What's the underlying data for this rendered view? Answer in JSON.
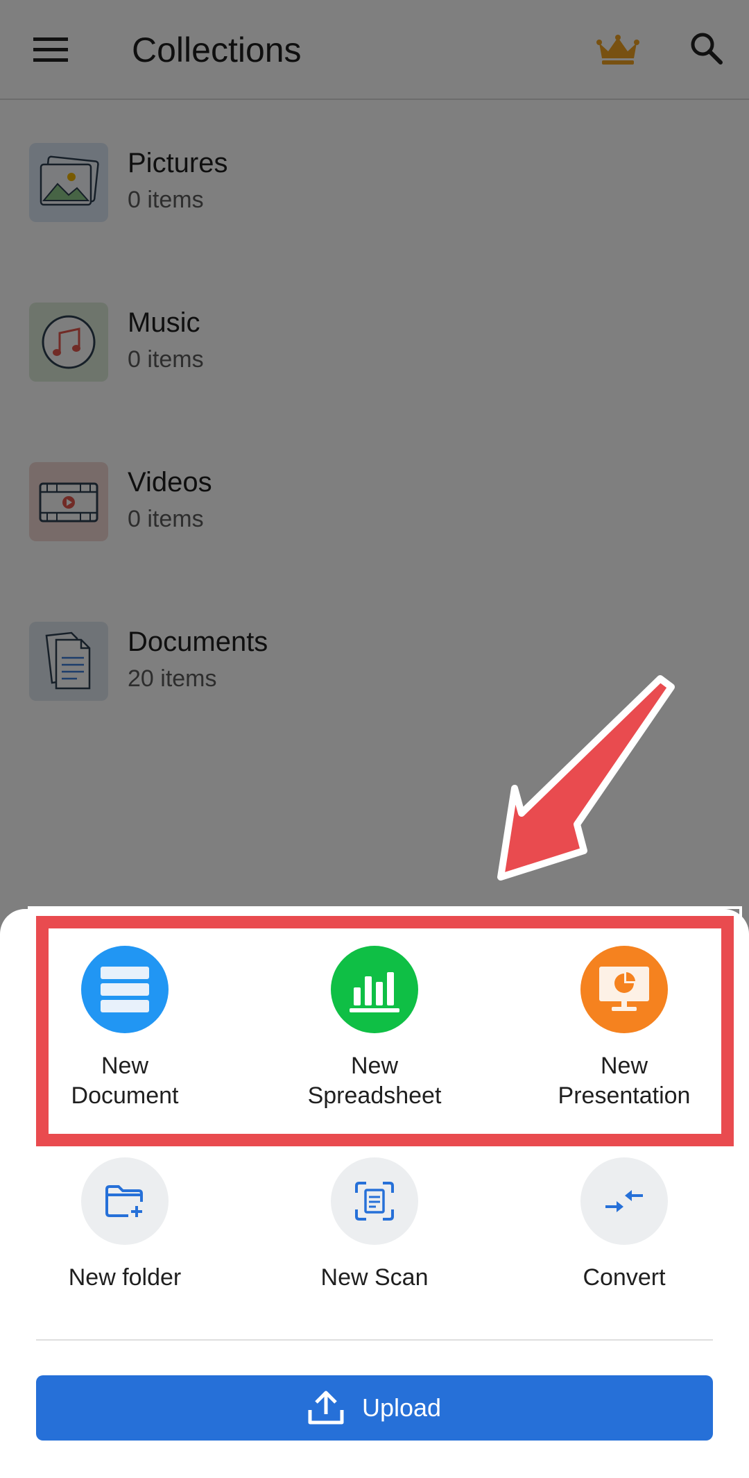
{
  "appbar": {
    "title": "Collections",
    "menu_icon": "hamburger-icon",
    "premium_icon": "crown-icon",
    "search_icon": "search-icon"
  },
  "collections": [
    {
      "name": "Pictures",
      "count": "0 items",
      "icon": "pictures-icon",
      "tint": "#dbe6f4"
    },
    {
      "name": "Music",
      "count": "0 items",
      "icon": "music-icon",
      "tint": "#dcebd9"
    },
    {
      "name": "Videos",
      "count": "0 items",
      "icon": "videos-icon",
      "tint": "#f0d7d3"
    },
    {
      "name": "Documents",
      "count": "20 items",
      "icon": "documents-icon",
      "tint": "#dfe6ef"
    }
  ],
  "sheet": {
    "new_document": {
      "line1": "New",
      "line2": "Document"
    },
    "new_spreadsheet": {
      "line1": "New",
      "line2": "Spreadsheet"
    },
    "new_presentation": {
      "line1": "New",
      "line2": "Presentation"
    },
    "new_folder": "New folder",
    "new_scan": "New Scan",
    "convert": "Convert",
    "upload": "Upload"
  },
  "colors": {
    "document": "#2196f3",
    "spreadsheet": "#0fbf45",
    "presentation": "#f5821f",
    "upload_button": "#2670d8",
    "annotation": "#e94b4f"
  }
}
